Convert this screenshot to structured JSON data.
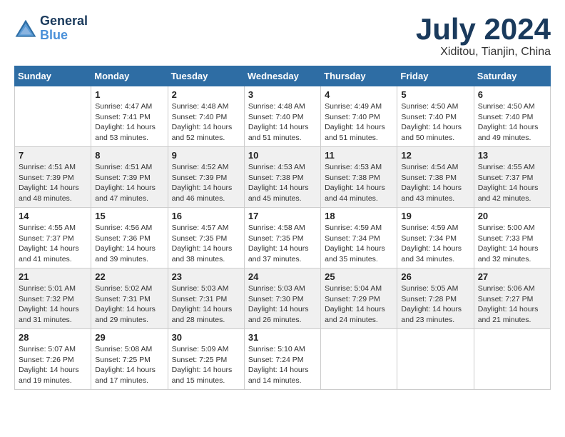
{
  "logo": {
    "line1": "General",
    "line2": "Blue"
  },
  "title": "July 2024",
  "location": "Xiditou, Tianjin, China",
  "days_of_week": [
    "Sunday",
    "Monday",
    "Tuesday",
    "Wednesday",
    "Thursday",
    "Friday",
    "Saturday"
  ],
  "weeks": [
    [
      {
        "day": "",
        "sunrise": "",
        "sunset": "",
        "daylight": ""
      },
      {
        "day": "1",
        "sunrise": "Sunrise: 4:47 AM",
        "sunset": "Sunset: 7:41 PM",
        "daylight": "Daylight: 14 hours and 53 minutes."
      },
      {
        "day": "2",
        "sunrise": "Sunrise: 4:48 AM",
        "sunset": "Sunset: 7:40 PM",
        "daylight": "Daylight: 14 hours and 52 minutes."
      },
      {
        "day": "3",
        "sunrise": "Sunrise: 4:48 AM",
        "sunset": "Sunset: 7:40 PM",
        "daylight": "Daylight: 14 hours and 51 minutes."
      },
      {
        "day": "4",
        "sunrise": "Sunrise: 4:49 AM",
        "sunset": "Sunset: 7:40 PM",
        "daylight": "Daylight: 14 hours and 51 minutes."
      },
      {
        "day": "5",
        "sunrise": "Sunrise: 4:50 AM",
        "sunset": "Sunset: 7:40 PM",
        "daylight": "Daylight: 14 hours and 50 minutes."
      },
      {
        "day": "6",
        "sunrise": "Sunrise: 4:50 AM",
        "sunset": "Sunset: 7:40 PM",
        "daylight": "Daylight: 14 hours and 49 minutes."
      }
    ],
    [
      {
        "day": "7",
        "sunrise": "Sunrise: 4:51 AM",
        "sunset": "Sunset: 7:39 PM",
        "daylight": "Daylight: 14 hours and 48 minutes."
      },
      {
        "day": "8",
        "sunrise": "Sunrise: 4:51 AM",
        "sunset": "Sunset: 7:39 PM",
        "daylight": "Daylight: 14 hours and 47 minutes."
      },
      {
        "day": "9",
        "sunrise": "Sunrise: 4:52 AM",
        "sunset": "Sunset: 7:39 PM",
        "daylight": "Daylight: 14 hours and 46 minutes."
      },
      {
        "day": "10",
        "sunrise": "Sunrise: 4:53 AM",
        "sunset": "Sunset: 7:38 PM",
        "daylight": "Daylight: 14 hours and 45 minutes."
      },
      {
        "day": "11",
        "sunrise": "Sunrise: 4:53 AM",
        "sunset": "Sunset: 7:38 PM",
        "daylight": "Daylight: 14 hours and 44 minutes."
      },
      {
        "day": "12",
        "sunrise": "Sunrise: 4:54 AM",
        "sunset": "Sunset: 7:38 PM",
        "daylight": "Daylight: 14 hours and 43 minutes."
      },
      {
        "day": "13",
        "sunrise": "Sunrise: 4:55 AM",
        "sunset": "Sunset: 7:37 PM",
        "daylight": "Daylight: 14 hours and 42 minutes."
      }
    ],
    [
      {
        "day": "14",
        "sunrise": "Sunrise: 4:55 AM",
        "sunset": "Sunset: 7:37 PM",
        "daylight": "Daylight: 14 hours and 41 minutes."
      },
      {
        "day": "15",
        "sunrise": "Sunrise: 4:56 AM",
        "sunset": "Sunset: 7:36 PM",
        "daylight": "Daylight: 14 hours and 39 minutes."
      },
      {
        "day": "16",
        "sunrise": "Sunrise: 4:57 AM",
        "sunset": "Sunset: 7:35 PM",
        "daylight": "Daylight: 14 hours and 38 minutes."
      },
      {
        "day": "17",
        "sunrise": "Sunrise: 4:58 AM",
        "sunset": "Sunset: 7:35 PM",
        "daylight": "Daylight: 14 hours and 37 minutes."
      },
      {
        "day": "18",
        "sunrise": "Sunrise: 4:59 AM",
        "sunset": "Sunset: 7:34 PM",
        "daylight": "Daylight: 14 hours and 35 minutes."
      },
      {
        "day": "19",
        "sunrise": "Sunrise: 4:59 AM",
        "sunset": "Sunset: 7:34 PM",
        "daylight": "Daylight: 14 hours and 34 minutes."
      },
      {
        "day": "20",
        "sunrise": "Sunrise: 5:00 AM",
        "sunset": "Sunset: 7:33 PM",
        "daylight": "Daylight: 14 hours and 32 minutes."
      }
    ],
    [
      {
        "day": "21",
        "sunrise": "Sunrise: 5:01 AM",
        "sunset": "Sunset: 7:32 PM",
        "daylight": "Daylight: 14 hours and 31 minutes."
      },
      {
        "day": "22",
        "sunrise": "Sunrise: 5:02 AM",
        "sunset": "Sunset: 7:31 PM",
        "daylight": "Daylight: 14 hours and 29 minutes."
      },
      {
        "day": "23",
        "sunrise": "Sunrise: 5:03 AM",
        "sunset": "Sunset: 7:31 PM",
        "daylight": "Daylight: 14 hours and 28 minutes."
      },
      {
        "day": "24",
        "sunrise": "Sunrise: 5:03 AM",
        "sunset": "Sunset: 7:30 PM",
        "daylight": "Daylight: 14 hours and 26 minutes."
      },
      {
        "day": "25",
        "sunrise": "Sunrise: 5:04 AM",
        "sunset": "Sunset: 7:29 PM",
        "daylight": "Daylight: 14 hours and 24 minutes."
      },
      {
        "day": "26",
        "sunrise": "Sunrise: 5:05 AM",
        "sunset": "Sunset: 7:28 PM",
        "daylight": "Daylight: 14 hours and 23 minutes."
      },
      {
        "day": "27",
        "sunrise": "Sunrise: 5:06 AM",
        "sunset": "Sunset: 7:27 PM",
        "daylight": "Daylight: 14 hours and 21 minutes."
      }
    ],
    [
      {
        "day": "28",
        "sunrise": "Sunrise: 5:07 AM",
        "sunset": "Sunset: 7:26 PM",
        "daylight": "Daylight: 14 hours and 19 minutes."
      },
      {
        "day": "29",
        "sunrise": "Sunrise: 5:08 AM",
        "sunset": "Sunset: 7:25 PM",
        "daylight": "Daylight: 14 hours and 17 minutes."
      },
      {
        "day": "30",
        "sunrise": "Sunrise: 5:09 AM",
        "sunset": "Sunset: 7:25 PM",
        "daylight": "Daylight: 14 hours and 15 minutes."
      },
      {
        "day": "31",
        "sunrise": "Sunrise: 5:10 AM",
        "sunset": "Sunset: 7:24 PM",
        "daylight": "Daylight: 14 hours and 14 minutes."
      },
      {
        "day": "",
        "sunrise": "",
        "sunset": "",
        "daylight": ""
      },
      {
        "day": "",
        "sunrise": "",
        "sunset": "",
        "daylight": ""
      },
      {
        "day": "",
        "sunrise": "",
        "sunset": "",
        "daylight": ""
      }
    ]
  ]
}
